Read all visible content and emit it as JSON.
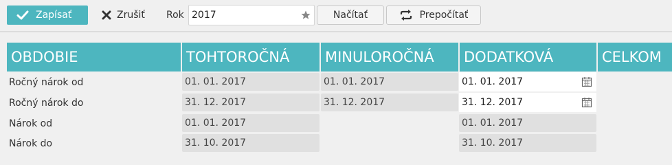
{
  "toolbar": {
    "save_label": "Zapísať",
    "cancel_label": "Zrušiť",
    "year_label": "Rok",
    "year_value": "2017",
    "load_label": "Načítať",
    "recalc_label": "Prepočítať"
  },
  "table": {
    "headers": [
      "OBDOBIE",
      "TOHTOROČNÁ",
      "MINULOROČNÁ",
      "DODATKOVÁ",
      "CELKOM"
    ],
    "rows": [
      {
        "label": "Ročný nárok od",
        "current": "01. 01. 2017",
        "previous": "01. 01. 2017",
        "additional": "01. 01. 2017"
      },
      {
        "label": "Ročný nárok do",
        "current": "31. 12. 2017",
        "previous": "31. 12. 2017",
        "additional": "31. 12. 2017"
      },
      {
        "label": "Nárok od",
        "current": "01. 01. 2017",
        "additional": "01. 01. 2017"
      },
      {
        "label": "Nárok do",
        "current": "31. 10. 2017",
        "additional": "31. 10. 2017"
      }
    ]
  },
  "colors": {
    "accent": "#4db6bf",
    "background": "#f0f0f0",
    "readonly_cell": "#e0e0e0"
  },
  "icons": {
    "save": "check-icon",
    "cancel": "close-icon",
    "favorite": "star-icon",
    "recalc": "refresh-icon",
    "calendar": "calendar-icon"
  }
}
